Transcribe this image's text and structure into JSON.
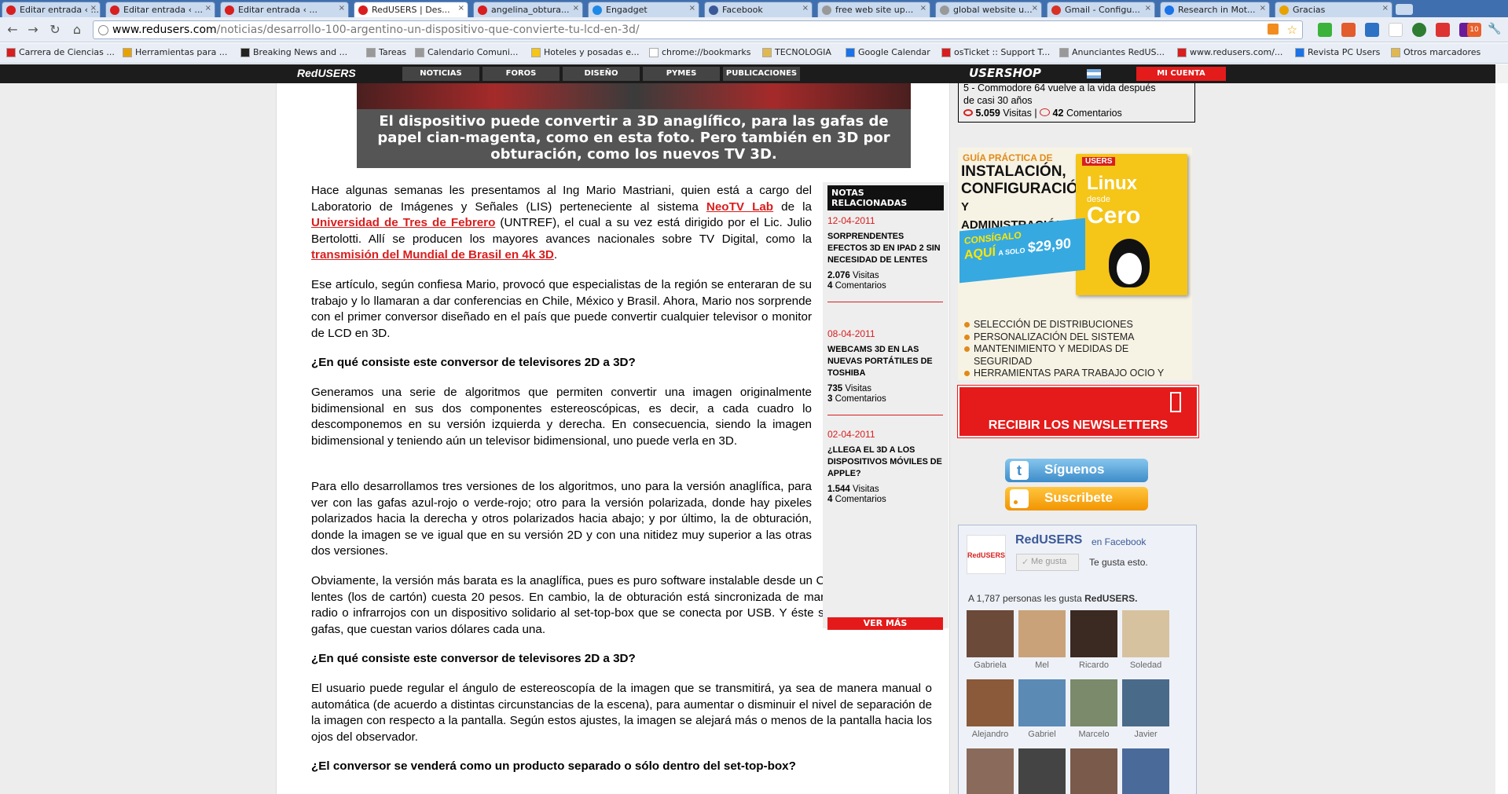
{
  "browser": {
    "tabs": [
      "Editar entrada ‹ ...",
      "Editar entrada ‹ ...",
      "Editar entrada ‹ ...",
      "RedUSERS | Des...",
      "angelina_obtura...",
      "Engadget",
      "Facebook",
      "free web site up...",
      "global website u...",
      "Gmail - Configu...",
      "Research in Mot...",
      "Gracias"
    ],
    "url_host": "www.redusers.com",
    "url_path": "/noticias/desarrollo-100-argentino-un-dispositivo-que-convierte-tu-lcd-en-3d/",
    "bookmarks": [
      "Carrera de Ciencias ...",
      "Herramientas para ...",
      "Breaking News and ...",
      "Tareas",
      "Calendario Comuni...",
      "Hoteles y posadas e...",
      "chrome://bookmarks",
      "TECNOLOGIA",
      "Google Calendar",
      "osTicket :: Support T...",
      "Anunciantes RedUS...",
      "www.redusers.com/...",
      "Revista PC Users",
      "Otros marcadores"
    ],
    "ext_badge": "10"
  },
  "site": {
    "logo": "RedUSERS",
    "nav": [
      "NOTICIAS",
      "FOROS",
      "DISEÑO",
      "PYMES",
      "PUBLICACIONES"
    ],
    "usershop": "USERSHOP",
    "mi_cuenta": "MI CUENTA"
  },
  "article": {
    "caption": "El dispositivo puede convertir a 3D anaglífico, para las gafas de papel cian-magenta, como en esta foto. Pero también en 3D por obturación, como los nuevos TV 3D.",
    "p1a": "Hace algunas semanas les presentamos al Ing Mario Mastriani, quien está a cargo del Laboratorio de Imágenes y Señales (LIS) perteneciente al sistema ",
    "p1_link1": "NeoTV Lab",
    "p1b": " de la ",
    "p1_link2": "Universidad de Tres de Febrero",
    "p1c": " (UNTREF), el cual a su vez está dirigido por el Lic. Julio Bertolotti. Allí  se producen los mayores avances nacionales sobre TV Digital, como la ",
    "p1_link3": "transmisión del Mundial de Brasil en 4k 3D",
    "p1d": ".",
    "p2": "Ese artículo, según confiesa Mario, provocó que especialistas de la región se enteraran de su trabajo y lo llamaran a dar conferencias en Chile, México y Brasil. Ahora, Mario nos sorprende con el primer conversor diseñado en el país que puede convertir cualquier televisor o monitor de LCD en 3D.",
    "q1": "¿En qué consiste este conversor de televisores 2D a 3D?",
    "p3": "Generamos una serie de algoritmos que permiten convertir una imagen originalmente bidimensional en sus dos componentes estereoscópicas, es decir, a cada cuadro lo descomponemos en su versión izquierda y derecha. En consecuencia, siendo la imagen bidimensional y teniendo aún un televisor bidimensional, uno puede verla en 3D.",
    "p4": "Para ello desarrollamos tres versiones de los algoritmos, uno para la versión anaglífica, para ver con las gafas azul-rojo o verde-rojo; otro para la versión polarizada, donde hay pixeles polarizados hacia la derecha y otros polarizados hacia abajo; y por último, la de obturación, donde la imagen se ve igual que en su versión 2D y con una nitidez muy superior a las otras dos versiones.",
    "p5": "Obviamente, la versión más barata es la anaglífica, pues es puro software instalable desde un CD y una caja de 100 lentes (los de cartón) cuesta 20 pesos. En cambio, la de obturación está sincronizada de manera inalámbrica por radio o infrarrojos con un dispositivo solidario al set-top-box que se conecta por USB. Y éste se sincroniza con las gafas, que cuestan varios dólares cada una.",
    "q2": "¿En qué consiste este conversor de televisores 2D a 3D?",
    "p6": "El usuario puede regular el ángulo de estereoscopía de la imagen que se transmitirá, ya sea de manera manual o automática (de acuerdo a distintas circunstancias de la escena), para aumentar o disminuir el nivel de separación de la imagen con respecto a la pantalla. Según estos ajustes, la imagen se alejará más o menos de la pantalla hacia los ojos del observador.",
    "q3": "¿El conversor se venderá como un producto separado o sólo dentro del set-top-box?"
  },
  "related": {
    "title": "NOTAS RELACIONADAS",
    "items": [
      {
        "date": "12-04-2011",
        "title": "SORPRENDENTES EFECTOS 3D EN IPAD 2 SIN NECESIDAD DE LENTES",
        "visits": "2.076",
        "visits_label": "Visitas",
        "comments": "4",
        "comments_label": "Comentarios"
      },
      {
        "date": "08-04-2011",
        "title": "WEBCAMS 3D EN LAS NUEVAS PORTÁTILES DE TOSHIBA",
        "visits": "735",
        "visits_label": "Visitas",
        "comments": "3",
        "comments_label": "Comentarios"
      },
      {
        "date": "02-04-2011",
        "title": "¿LLEGA EL 3D A LOS DISPOSITIVOS MÓVILES DE APPLE?",
        "visits": "1.544",
        "visits_label": "Visitas",
        "comments": "4",
        "comments_label": "Comentarios"
      }
    ],
    "more": "VER MÁS"
  },
  "sidebar": {
    "top_l1": "5 - Commodore 64 vuelve a la vida después",
    "top_l2": "de casi 30 años",
    "top_visits": "5.059",
    "top_visits_label": "Visitas",
    "top_sep": "|",
    "top_comments": "42",
    "top_comments_label": "Comentarios",
    "ad_title1": "GUÍA PRÁCTICA DE",
    "ad_title2": "INSTALACIÓN,",
    "ad_title3": "CONFIGURACIÓN",
    "ad_title4": "Y ADMINISTRACIÓN",
    "ad_book_brand": "USERS",
    "ad_book_title": "Linux",
    "ad_book_desde": "desde",
    "ad_book_cero": "Cero",
    "ad_promo1": "CONSÍGALO",
    "ad_promo2": "AQUÍ",
    "ad_promo3": "A SOLO",
    "ad_price": "$29,90",
    "ad_bullets": [
      "SELECCIÓN DE DISTRIBUCIONES",
      "PERSONALIZACIÓN DEL SISTEMA",
      "MANTENIMIENTO Y MEDIDAS DE SEGURIDAD",
      "HERRAMIENTAS PARA TRABAJO OCIO Y COMUNICACIONES"
    ],
    "newsletter": "RECIBIR LOS NEWSLETTERS",
    "twitter": "Síguenos",
    "rss": "Suscribete",
    "fb_logo": "RedUSERS",
    "fb_name": "RedUSERS",
    "fb_en": "en Facebook",
    "fb_like": "Me gusta",
    "fb_likes_this": "Te gusta esto.",
    "fb_count_prefix": "A 1,787 personas les gusta",
    "fb_count_name": "RedUSERS.",
    "fb_people": [
      "Gabriela",
      "Mel",
      "Ricardo",
      "Soledad",
      "Alejandro",
      "Gabriel",
      "Marcelo",
      "Javier"
    ]
  }
}
